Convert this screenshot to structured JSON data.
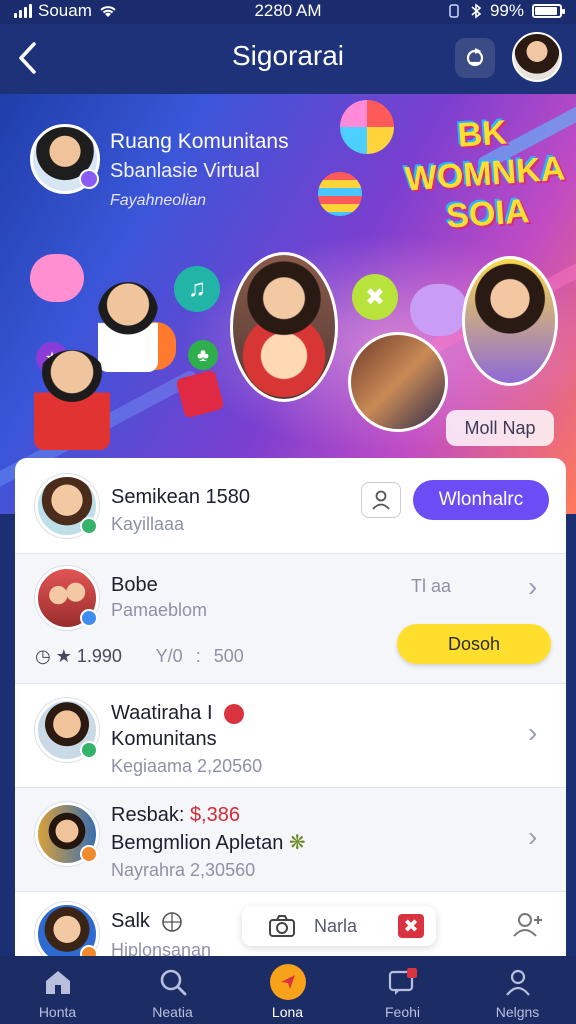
{
  "status_bar": {
    "carrier": "Souam",
    "time": "2280 AM",
    "battery": "99%",
    "battery_level": 0.9,
    "bluetooth_icon": "bluetooth-icon",
    "wifi_icon": "wifi-icon"
  },
  "header": {
    "title": "Sigorarai",
    "back_icon": "chevron-left-icon",
    "action_icon": "refresh-icon"
  },
  "banner": {
    "title": "Ruang Komunitans",
    "subtitle": "Sbanlasie Virtual",
    "tagline": "Fayahneolian",
    "logo_text": "BK WOMNKA SOIA",
    "button_label": "Moll Nap"
  },
  "list": [
    {
      "name": "Semikean 1580",
      "sub": "Kayillaaa",
      "action_label": "Wlonhalrc",
      "badge_color": "#36b36a"
    },
    {
      "name": "Bobe",
      "sub": "Pamaeblom",
      "side_text": "Tl aa",
      "action_label": "Dosoh",
      "stat_1": "1.990",
      "stat_2": "Y/0",
      "stat_3": "500",
      "badge_color": "#3f8df0"
    },
    {
      "name": "Waatiraha I",
      "name_line2": "Komunitans",
      "sub": "Kegiaama  2,20560",
      "badge_color": "#36b36a"
    },
    {
      "name_prefix": "Resbak:",
      "name_price": "$,386",
      "name_line2": "Bemgmlion Apletan",
      "sub": "Nayrahra  2,30560",
      "badge_color": "#f08a2c"
    },
    {
      "name": "Salk",
      "sub": "Hiplonsanan",
      "badge_color": "#f08a2c"
    }
  ],
  "camera_chip": {
    "label": "Narla"
  },
  "nav": {
    "items": [
      {
        "label": "Honta",
        "icon": "home-icon"
      },
      {
        "label": "Neatia",
        "icon": "search-icon"
      },
      {
        "label": "Lona",
        "icon": "create-icon"
      },
      {
        "label": "Feohi",
        "icon": "chat-icon"
      },
      {
        "label": "Nelgns",
        "icon": "profile-icon"
      }
    ]
  },
  "colors": {
    "header_bg": "#1d3278",
    "accent_purple": "#6b4cf5",
    "accent_yellow": "#ffdf2c",
    "nav_bg": "#1c2d66"
  }
}
